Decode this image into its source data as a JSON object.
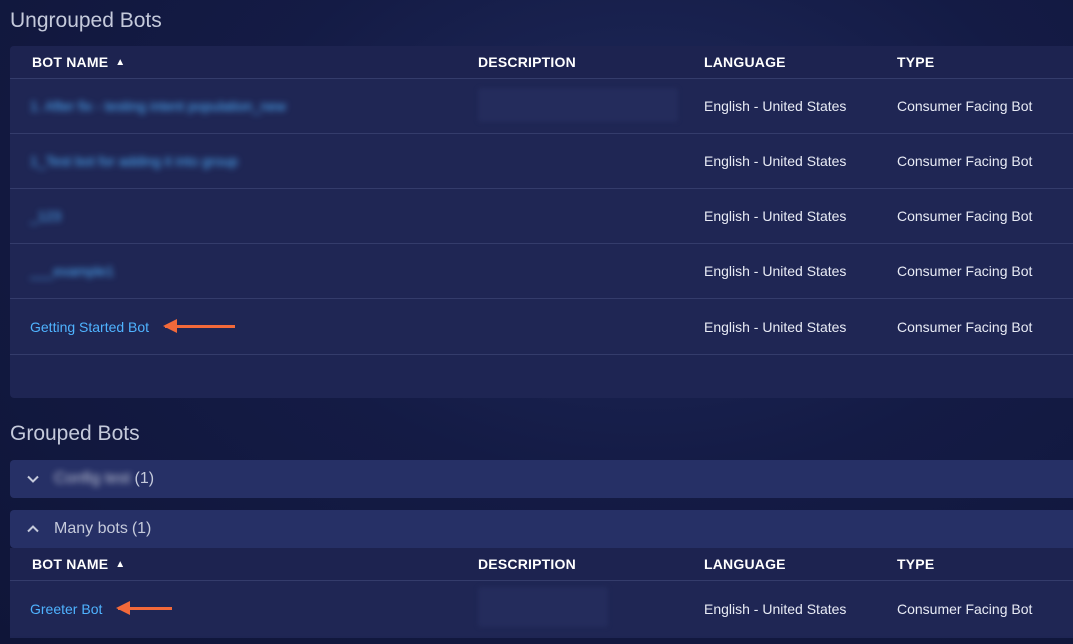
{
  "ungrouped": {
    "title": "Ungrouped Bots",
    "columns": {
      "name": "BOT NAME",
      "description": "DESCRIPTION",
      "language": "LANGUAGE",
      "type": "TYPE"
    },
    "rows": [
      {
        "name": "1. After fix - testing intent population_new",
        "language": "English - United States",
        "type": "Consumer Facing Bot"
      },
      {
        "name": "1_Test bot for adding it into group",
        "language": "English - United States",
        "type": "Consumer Facing Bot"
      },
      {
        "name": "_123",
        "language": "English - United States",
        "type": "Consumer Facing Bot"
      },
      {
        "name": "___example1",
        "language": "English - United States",
        "type": "Consumer Facing Bot"
      },
      {
        "name": "Getting Started Bot",
        "language": "English - United States",
        "type": "Consumer Facing Bot"
      }
    ]
  },
  "grouped": {
    "title": "Grouped Bots",
    "groups": [
      {
        "name": "Config test",
        "count": "(1)",
        "state": "collapsed"
      },
      {
        "name": "Many bots",
        "count": "(1)",
        "state": "expanded"
      }
    ],
    "columns": {
      "name": "BOT NAME",
      "description": "DESCRIPTION",
      "language": "LANGUAGE",
      "type": "TYPE"
    },
    "rows": [
      {
        "name": "Greeter Bot",
        "language": "English - United States",
        "type": "Consumer Facing Bot"
      }
    ]
  },
  "icons": {
    "sort": "sort-ascending-icon",
    "collapsed": "chevron-down-icon",
    "expanded": "chevron-up-icon",
    "annotation": "arrow-left-icon"
  },
  "colors": {
    "link": "#4fb3ff",
    "annotation_arrow": "#f2693a",
    "panel": "#1e2553"
  }
}
